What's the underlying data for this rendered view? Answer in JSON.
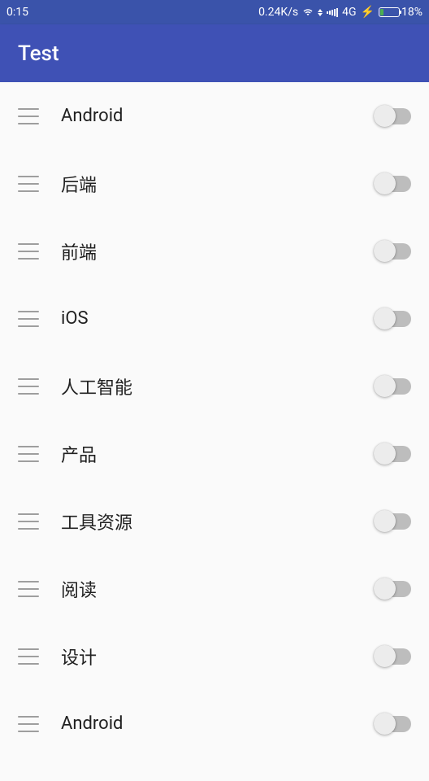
{
  "status_bar": {
    "time": "0:15",
    "net_speed": "0.24K/s",
    "network_type": "4G",
    "battery_percent": "18%"
  },
  "app_bar": {
    "title": "Test"
  },
  "list": {
    "items": [
      {
        "label": "Android"
      },
      {
        "label": "后端"
      },
      {
        "label": "前端"
      },
      {
        "label": "iOS"
      },
      {
        "label": "人工智能"
      },
      {
        "label": "产品"
      },
      {
        "label": "工具资源"
      },
      {
        "label": "阅读"
      },
      {
        "label": "设计"
      },
      {
        "label": "Android"
      }
    ]
  }
}
